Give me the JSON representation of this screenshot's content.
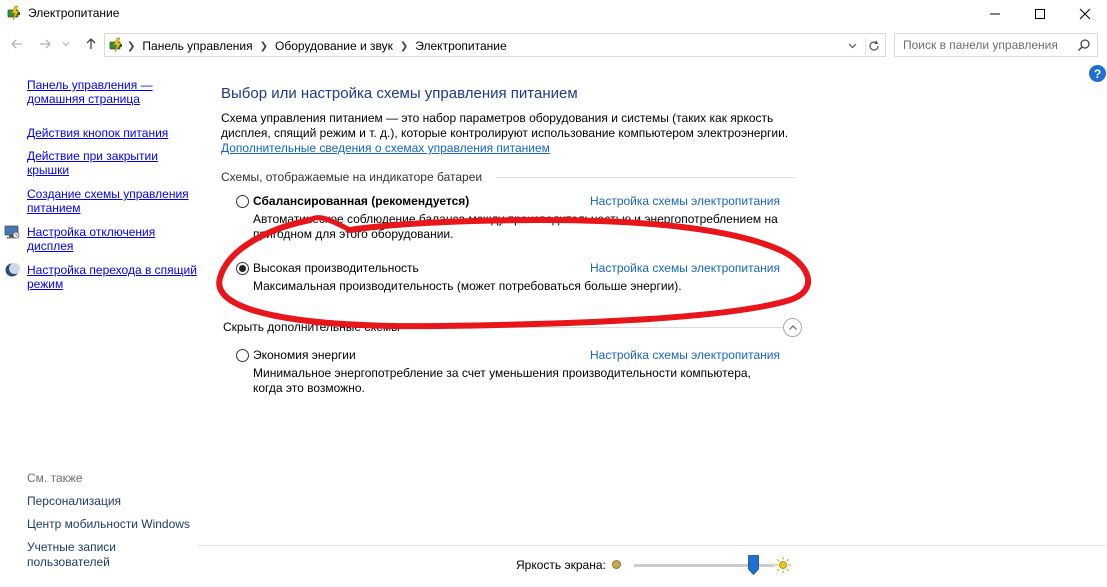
{
  "window": {
    "title": "Электропитание"
  },
  "nav": {
    "breadcrumbs": [
      "Панель управления",
      "Оборудование и звук",
      "Электропитание"
    ],
    "search_placeholder": "Поиск в панели управления"
  },
  "sidebar": {
    "items": [
      {
        "label": "Панель управления — домашняя страница",
        "icon": "none"
      },
      {
        "label": "Действия кнопок питания",
        "icon": "none"
      },
      {
        "label": "Действие при закрытии крышки",
        "icon": "none"
      },
      {
        "label": "Создание схемы управления питанием",
        "icon": "none"
      },
      {
        "label": "Настройка отключения дисплея",
        "icon": "monitor-icon"
      },
      {
        "label": "Настройка перехода в спящий режим",
        "icon": "moon-icon"
      }
    ],
    "see_also_label": "См. также",
    "see_also": [
      {
        "label": "Персонализация"
      },
      {
        "label": "Центр мобильности Windows"
      },
      {
        "label": "Учетные записи пользователей"
      }
    ]
  },
  "main": {
    "title": "Выбор или настройка схемы управления питанием",
    "description": "Схема управления питанием — это набор параметров оборудования и системы (таких как яркость дисплея, спящий режим и т. д.), которые контролируют использование компьютером электроэнергии.",
    "more_link": "Дополнительные сведения о схемах управления питанием",
    "battery_group_label": "Схемы, отображаемые на индикаторе батареи",
    "hide_label": "Скрыть дополнительные схемы",
    "config_label": "Настройка схемы электропитания",
    "plans": [
      {
        "name": "Сбалансированная (рекомендуется)",
        "description": "Автоматическое соблюдение баланса между производительностью и энергопотреблением на пригодном для этого оборудовании.",
        "selected": false,
        "bold": true
      },
      {
        "name": "Высокая производительность",
        "description": "Максимальная производительность (может потребоваться больше энергии).",
        "selected": true,
        "bold": false
      },
      {
        "name": "Экономия энергии",
        "description": "Минимальное энергопотребление за счет уменьшения производительности компьютера, когда это возможно.",
        "selected": false,
        "bold": false
      }
    ]
  },
  "brightness": {
    "label": "Яркость экрана:",
    "value_percent": 85
  },
  "colors": {
    "title_blue": "#1e3a8a",
    "link_blue": "#1565c0",
    "nav_link": "#1f3a6d",
    "annotation_red": "#e8161b",
    "slider_thumb": "#1e6fcf"
  }
}
